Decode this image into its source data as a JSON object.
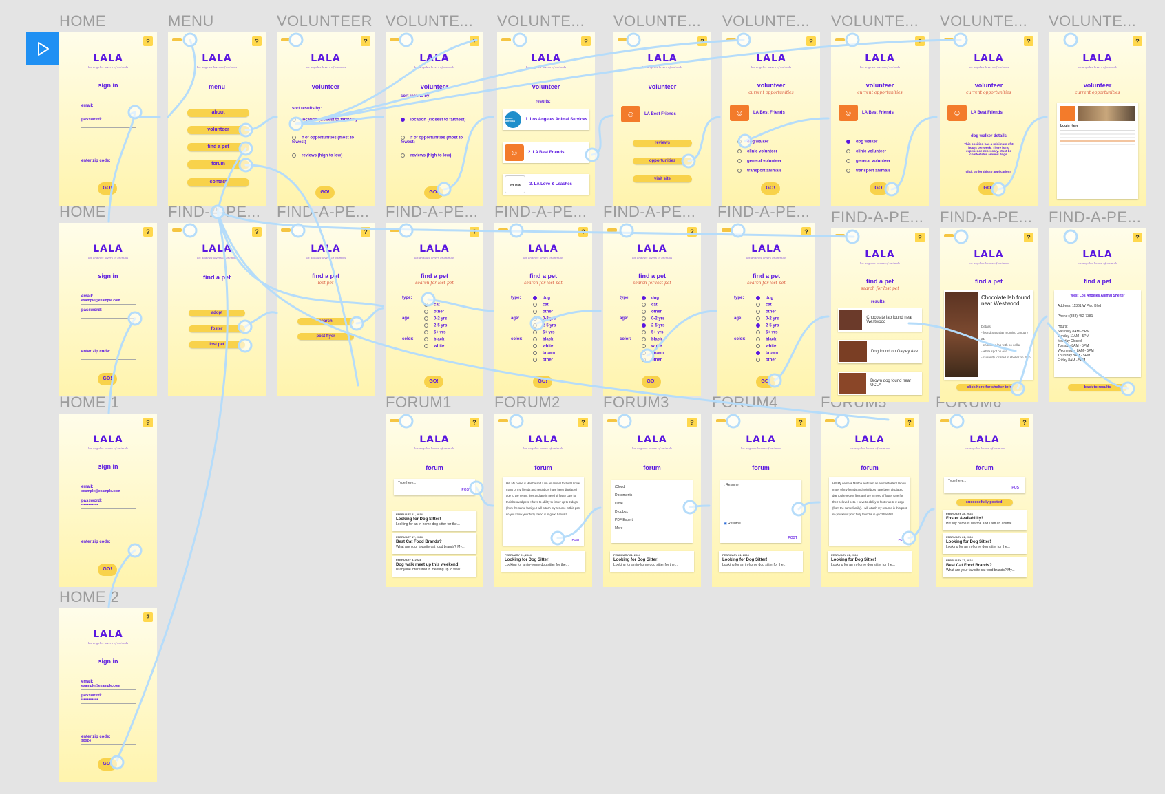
{
  "toolbar": {
    "play_icon": "play-icon"
  },
  "frame_labels": [
    "HOME",
    "MENU",
    "VOLUNTEER",
    "VOLUNTE...",
    "VOLUNTE...",
    "VOLUNTE...",
    "VOLUNTE...",
    "VOLUNTE...",
    "VOLUNTE...",
    "VOLUNTE...",
    "HOME",
    "FIND-A-PE...",
    "FIND-A-PE...",
    "FIND-A-PE...",
    "FIND-A-PE...",
    "FIND-A-PE...",
    "FIND-A-PE...",
    "FIND-A-PE...",
    "FIND-A-PE...",
    "FIND-A-PE...",
    "HOME 1",
    "FORUM1",
    "FORUM2",
    "FORUM3",
    "FORUM4",
    "FORUM5",
    "FORUM6",
    "HOME 2"
  ],
  "app": {
    "logo": "LALA",
    "tagline": "los angeles lovers of animals",
    "help": "?"
  },
  "home": {
    "title": "sign in",
    "email_label": "email:",
    "password_label": "password:",
    "zip_label": "enter zip code:",
    "go": "GO!",
    "email_value": "example@example.com",
    "password_value": "••••••••••••••",
    "zip_value": "90024"
  },
  "menu": {
    "title": "menu",
    "items": [
      "about",
      "volunteer",
      "find a pet",
      "forum",
      "contact"
    ]
  },
  "volunteer": {
    "title": "volunteer",
    "sub": "current opportunities",
    "sort_label": "sort results by:",
    "options": [
      "location (closest to farthest)",
      "# of opportunities (most to fewest)",
      "reviews (high to low)"
    ],
    "results_label": "results:",
    "orgs": [
      "1. Los Angeles Animal Services",
      "2. LA Best Friends",
      "3. LA Love & Leashes"
    ],
    "org_icon_texts": [
      "ANIMAL SERVICES",
      "ove",
      "leas"
    ],
    "lbf": "LA Best Friends",
    "lbf_buttons": [
      "reviews",
      "opportunities",
      "visit site"
    ],
    "roles": [
      "dog walker",
      "clinic volunteer",
      "general volunteer",
      "transport animals"
    ],
    "details_title": "dog walker details",
    "details_text": "This position has a minimum of 3 hours per week. There is no experience necessary. Must be comfortable around dogs.",
    "apply": "click go for this to application!!",
    "login_title": "Login Here"
  },
  "find": {
    "title": "find a pet",
    "sub_lost": "lost pet",
    "sub_search": "search for lost pet",
    "menu_items": [
      "adopt",
      "foster",
      "lost pet"
    ],
    "lost_items": [
      "search",
      "post flyer"
    ],
    "type_label": "type:",
    "types": [
      "dog",
      "cat",
      "other"
    ],
    "age_label": "age:",
    "ages": [
      "0-2 yrs",
      "2-5 yrs",
      "5+ yrs"
    ],
    "color_label": "color:",
    "colors": [
      "black",
      "white",
      "brown",
      "other"
    ],
    "results_label": "results:",
    "pets": [
      "Chocolate lab found near Westwood",
      "Dog found on Gayley Ave",
      "Brown dog found near UCLA"
    ],
    "detail_title": "Chocolate lab found near Westwood",
    "detail_lines": [
      "Details:",
      "- found Saturday morning January 21",
      "- chocolate lab with no collar",
      "- white spot on ear",
      "- currently located in shelter on Pico"
    ],
    "shelter_btn": "click here for shelter info",
    "shelter_name": "West Los Angeles Animal Shelter",
    "shelter_address": "Address: 11361 W Pico Blvd",
    "shelter_phone": "Phone: (888) 452-7381",
    "hours_label": "Hours:",
    "hours": [
      "Saturday 8AM - 5PM",
      "Sunday 11AM - 5PM",
      "Monday Closed",
      "Tuesday 8AM - 5PM",
      "Wednesday 8AM - 5PM",
      "Thursday 8AM - 5PM",
      "Friday 8AM - 5PM"
    ],
    "back": "back to results"
  },
  "forum": {
    "title": "forum",
    "placeholder": "Type here...",
    "post": "POST",
    "posts": [
      {
        "date": "FEBRUARY 21, 2024",
        "title": "Looking for Dog Sitter!",
        "body": "Looking for an in-home dog sitter for the..."
      },
      {
        "date": "FEBRUARY 17, 2024",
        "title": "Best Cat Food Brands?",
        "body": "What are your favorite cat food brands? My..."
      },
      {
        "date": "FEBRUARY 4, 2024",
        "title": "Dog walk meet up this weekend!",
        "body": "Is anyone interested in meeting up to walk..."
      }
    ],
    "draft": "Hi!! My name is Martha and I am an animal foster!! I know many of my friends and neighbors have been displaced due to the recent fires and are in need of foster care for their beloved pets. I have to ability to foster up to 2 dogs (from the same family). I will attach my resume in this post so you know your furry friend is in good hands!!",
    "files": [
      "iCloud",
      "Documents",
      "Drive",
      "Dropbox",
      "PDF Expert",
      "More"
    ],
    "resume": "Resume",
    "success": "successfully posted!",
    "new_post": {
      "date": "FEBRUARY 28, 2024",
      "title": "Foster Availability!",
      "body": "Hi!! My name is Martha and I am an animal..."
    }
  }
}
